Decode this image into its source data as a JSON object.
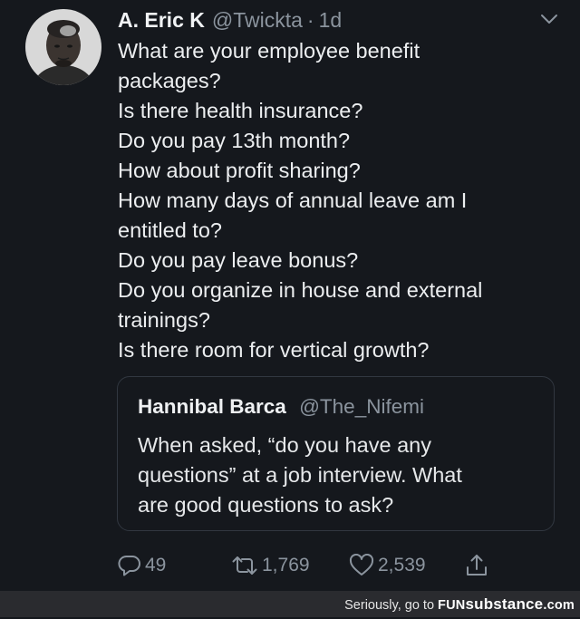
{
  "tweet": {
    "display_name": "A. Eric K",
    "handle": "@Twickta",
    "separator": "·",
    "time": "1d",
    "avatar_icon": "profile-photo",
    "menu_icon": "chevron-down-icon",
    "lines": [
      "What are your employee benefit",
      "packages?",
      "Is there health insurance?",
      "Do you pay 13th month?",
      "How about profit sharing?",
      "How many days of annual leave am I",
      "entitled to?",
      "Do you pay leave bonus?",
      "Do you organize in house and external",
      "trainings?",
      "Is there room for vertical growth?"
    ]
  },
  "quoted": {
    "display_name": "Hannibal Barca",
    "handle": "@The_Nifemi",
    "lines": [
      "When asked, “do you have any",
      "questions” at a job interview. What",
      "are good questions to ask?"
    ]
  },
  "actions": {
    "reply_count": "49",
    "retweet_count": "1,769",
    "like_count": "2,539",
    "reply_icon": "reply-icon",
    "retweet_icon": "retweet-icon",
    "like_icon": "heart-icon",
    "share_icon": "share-icon"
  },
  "footer": {
    "prefix": "Seriously, go to ",
    "brand_part1": "FUN",
    "brand_part2": "substance",
    "brand_part3": ".com"
  },
  "colors": {
    "background": "#15181d",
    "text": "#e8eaec",
    "muted": "#8b949e",
    "border": "#313740",
    "footer_bg": "#2a2b2f"
  }
}
